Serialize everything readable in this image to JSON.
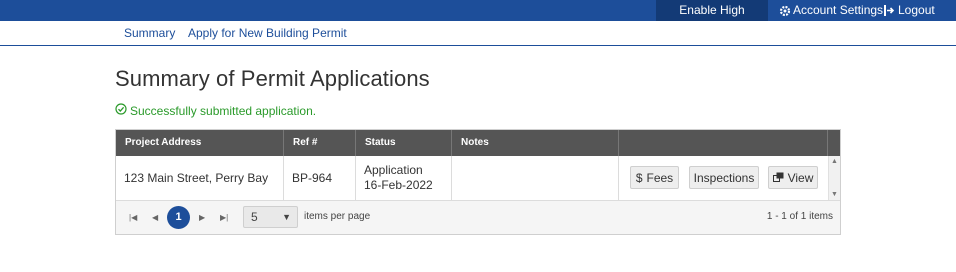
{
  "topbar": {
    "high_contrast": "Enable High Contrast",
    "account_settings": "Account Settings",
    "logout": "Logout",
    "bg_color": "#1d4e9a"
  },
  "subnav": {
    "summary": "Summary",
    "apply": "Apply for New Building Permit"
  },
  "page": {
    "title": "Summary of Permit Applications",
    "success_message": "Successfully submitted application."
  },
  "grid": {
    "columns": [
      "Project Address",
      "Ref #",
      "Status",
      "Notes",
      ""
    ],
    "rows": [
      {
        "address": "123 Main Street, Perry Bay",
        "ref": "BP-964",
        "status_line1": "Application",
        "status_line2": "16-Feb-2022",
        "notes": "",
        "actions": {
          "fees": "Fees",
          "inspections": "Inspections",
          "view": "View"
        }
      }
    ],
    "pager": {
      "current_page": "1",
      "page_size": "5",
      "items_per_page": "items per page",
      "info": "1 - 1 of 1 items"
    }
  }
}
